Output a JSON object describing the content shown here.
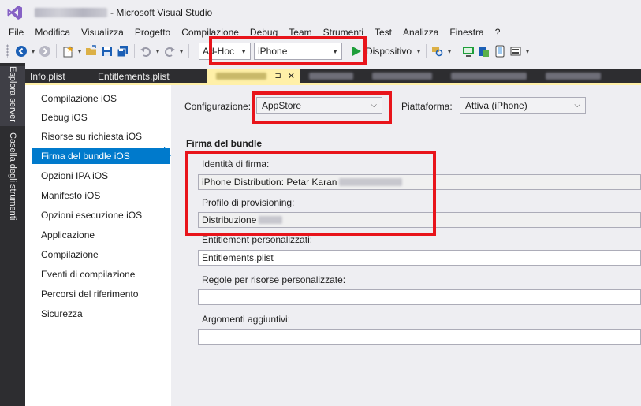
{
  "window": {
    "title": "- Microsoft Visual Studio"
  },
  "menu": [
    "File",
    "Modifica",
    "Visualizza",
    "Progetto",
    "Compilazione",
    "Debug",
    "Team",
    "Strumenti",
    "Test",
    "Analizza",
    "Finestra",
    "?"
  ],
  "toolbar": {
    "config_value": "Ad-Hoc",
    "platform_value": "iPhone",
    "run_label": "Dispositivo"
  },
  "side_tabs": [
    "Esplora server",
    "Casella degli strumenti"
  ],
  "doc_tabs": {
    "first": "Info.plist",
    "second": "Entitlements.plist",
    "pin": "⊐",
    "close": "✕"
  },
  "nav": {
    "items": [
      "Compilazione iOS",
      "Debug iOS",
      "Risorse su richiesta iOS",
      "Firma del bundle iOS",
      "Opzioni IPA iOS",
      "Manifesto iOS",
      "Opzioni esecuzione iOS",
      "Applicazione",
      "Compilazione",
      "Eventi di compilazione",
      "Percorsi del riferimento",
      "Sicurezza"
    ],
    "selected_index": 3
  },
  "form": {
    "config_label": "Configurazione:",
    "config_value": "AppStore",
    "platform_label": "Piattaforma:",
    "platform_value": "Attiva (iPhone)",
    "section_title": "Firma del bundle",
    "identity_label": "Identità di firma:",
    "identity_value": "iPhone Distribution: Petar Karan",
    "profile_label": "Profilo di provisioning:",
    "profile_value": "Distribuzione",
    "entitlements_label": "Entitlement personalizzati:",
    "entitlements_value": "Entitlements.plist",
    "rules_label": "Regole per risorse personalizzate:",
    "rules_value": "",
    "args_label": "Argomenti aggiuntivi:",
    "args_value": ""
  },
  "colors": {
    "accent": "#007acc",
    "highlight": "#e8141b",
    "active_tab": "#fff0a8",
    "dark_chrome": "#2d2d30"
  }
}
